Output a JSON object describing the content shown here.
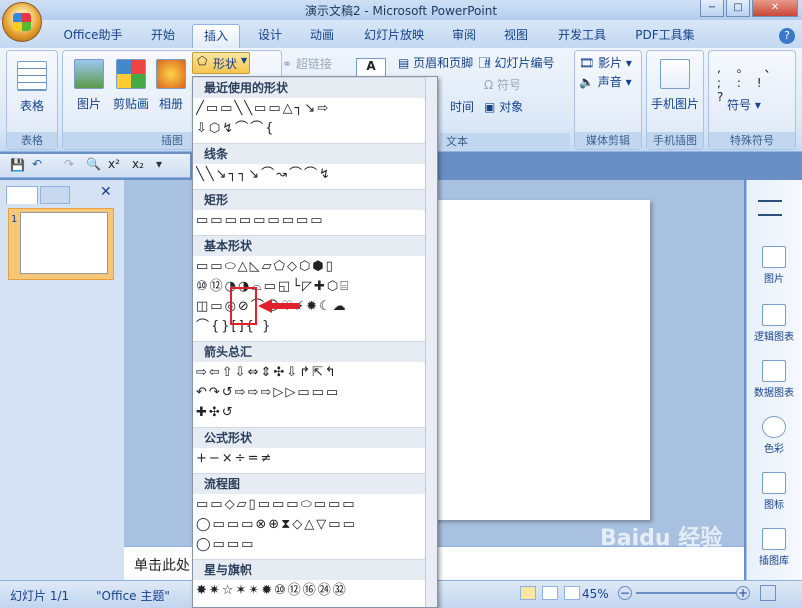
{
  "window": {
    "title": "演示文稿2 - Microsoft PowerPoint",
    "min": "−",
    "max": "□",
    "close": "✕"
  },
  "tabs": [
    "Office助手",
    "开始",
    "插入",
    "设计",
    "动画",
    "幻灯片放映",
    "审阅",
    "视图",
    "开发工具",
    "PDF工具集"
  ],
  "active_tab": "插入",
  "help": "?",
  "ribbon": {
    "table_group": {
      "button": "表格",
      "label": "表格"
    },
    "illustrations_group": {
      "picture": "图片",
      "clipart": "剪贴画",
      "album": "相册",
      "shapes": "形状",
      "label": "插图"
    },
    "links": {
      "hyperlink": "超链接",
      "textbox_icon": "A"
    },
    "header_footer": "页眉和页脚",
    "slide_number": "幻灯片编号",
    "symbol": "符号",
    "datetime": "时间",
    "object": "对象",
    "text_label": "文本",
    "media": {
      "movie": "影片",
      "sound": "声音",
      "label": "媒体剪辑"
    },
    "phone": {
      "button": "手机图片",
      "label": "手机插图"
    },
    "special": {
      "button": "符号",
      "label": "特殊符号",
      "chars": ", 。 、 ; : ! ?"
    }
  },
  "toolbar": {
    "bold_sup": "x²",
    "sub": "x₂"
  },
  "notes_placeholder": "单击此处",
  "right_panel": [
    "图片",
    "逻辑图表",
    "数据图表",
    "色彩",
    "图标",
    "插图库"
  ],
  "status": {
    "slide": "幻灯片 1/1",
    "theme": "\"Office 主题\"",
    "zoom": "45%"
  },
  "dropdown": {
    "categories": [
      {
        "title": "最近使用的形状",
        "rows": [
          "╱▭▭╲╲▭▭△┐↘⇨",
          "⇩⬡↯⌒⌒{"
        ]
      },
      {
        "title": "线条",
        "rows": [
          "╲╲↘┐┐↘⌒↝⌒⌒↯"
        ]
      },
      {
        "title": "矩形",
        "rows": [
          "▭▭▭▭▭▭▭▭▭"
        ]
      },
      {
        "title": "基本形状",
        "rows": [
          "▭▭⬭△◺▱⬠◇⬡⬢▯",
          "⑩⑫◔◑⌓▭◱└◸✚⬡⌸",
          "◫▭◎⊘⌒☺♡⚡✹☾☁",
          "⌒{}[]{ }"
        ]
      },
      {
        "title": "箭头总汇",
        "rows": [
          "⇨⇦⇧⇩⇔⇕✣⇩↱⇱↰",
          "↶↷↺⇨⇨⇨▷▷▭▭▭",
          "✚✣↺"
        ]
      },
      {
        "title": "公式形状",
        "rows": [
          "+−×÷=≠"
        ]
      },
      {
        "title": "流程图",
        "rows": [
          "▭▭◇▱▯▭▭▭⬭▭▭▭",
          "◯▭▭▭⊗⊕⧗◇△▽▭▭",
          "◯▭▭▭"
        ]
      },
      {
        "title": "星与旗帜",
        "rows": [
          "✸✷☆✶✴✹⑩⑫⑯㉔㉜",
          "▭▭▭▭▭▭▭▭"
        ]
      }
    ]
  },
  "watermark": "Baidu 经验"
}
